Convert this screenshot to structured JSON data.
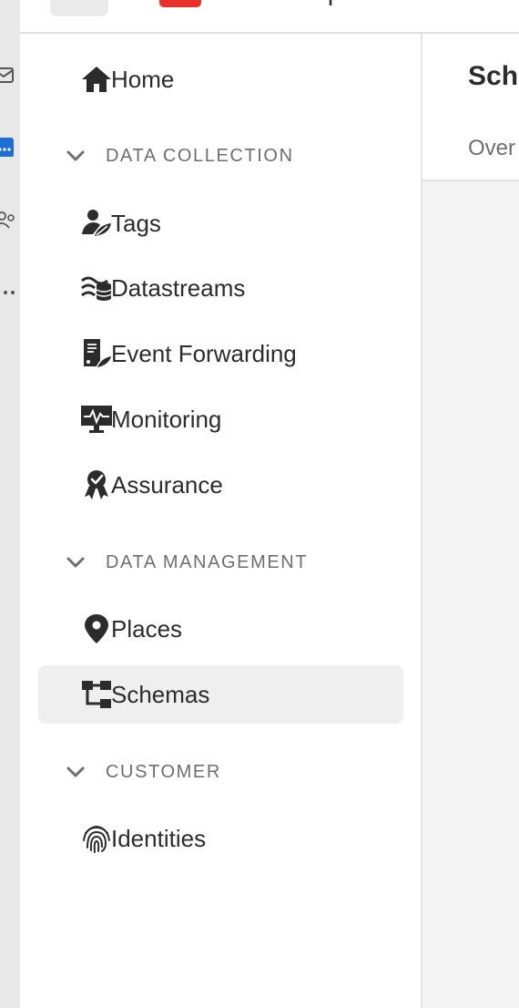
{
  "sidebar": {
    "home": {
      "label": "Home",
      "icon": "home-icon"
    },
    "sections": [
      {
        "title": "DATA COLLECTION",
        "items": [
          {
            "label": "Tags",
            "icon": "tags-icon"
          },
          {
            "label": "Datastreams",
            "icon": "datastreams-icon"
          },
          {
            "label": "Event Forwarding",
            "icon": "event-forwarding-icon"
          },
          {
            "label": "Monitoring",
            "icon": "monitoring-icon"
          },
          {
            "label": "Assurance",
            "icon": "assurance-icon"
          }
        ]
      },
      {
        "title": "DATA MANAGEMENT",
        "items": [
          {
            "label": "Places",
            "icon": "location-pin-icon"
          },
          {
            "label": "Schemas",
            "icon": "schema-icon",
            "selected": true
          }
        ]
      },
      {
        "title": "CUSTOMER",
        "items": [
          {
            "label": "Identities",
            "icon": "fingerprint-icon"
          }
        ]
      }
    ]
  },
  "main": {
    "title": "Sche",
    "tab": "Over"
  },
  "colors": {
    "brand": "#e8312a",
    "text": "#2c2c2c",
    "section_text": "#6e6e6e",
    "selected_bg": "#efefef"
  }
}
